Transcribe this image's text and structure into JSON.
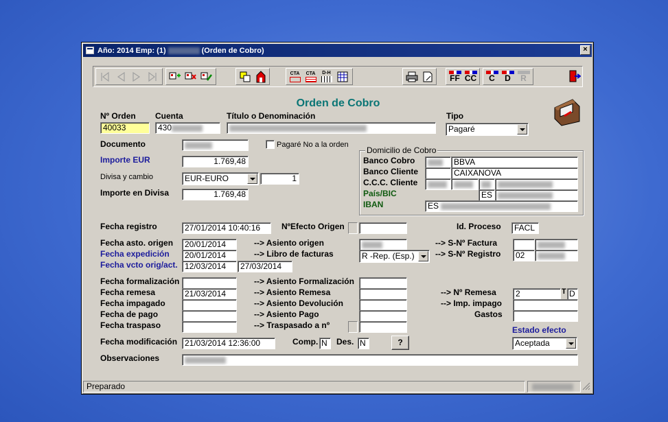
{
  "window": {
    "title_prefix": "Año: 2014 Emp: (1)",
    "title_suffix": "(Orden de Cobro)",
    "close": "×"
  },
  "toolbar": {
    "cta": "CTA",
    "dh": "D-H",
    "ff": "FF",
    "cc": "CC",
    "c": "C",
    "d": "D",
    "r": "R"
  },
  "form": {
    "heading": "Orden de Cobro",
    "n_orden_label": "Nº Orden",
    "n_orden": "40033",
    "cuenta_label": "Cuenta",
    "cuenta": "430",
    "titulo_label": "Título o Denominación",
    "tipo_label": "Tipo",
    "tipo": "Pagaré",
    "documento_label": "Documento",
    "pagare_no_label": "Pagaré No a la orden",
    "importe_eur_label": "Importe EUR",
    "importe_eur": "1.769,48",
    "divisa_label": "Divisa y cambio",
    "divisa": "EUR-EURO",
    "cambio": "1",
    "importe_divisa_label": "Importe en Divisa",
    "importe_divisa": "1.769,48",
    "domicilio": {
      "title": "Domicilio de Cobro",
      "banco_cobro_label": "Banco Cobro",
      "banco_cobro": "BBVA",
      "banco_cliente_label": "Banco Cliente",
      "banco_cliente": "CAIXANOVA",
      "ccc_label": "C.C.C. Cliente",
      "pais_label": "País/BIC",
      "pais": "ES",
      "iban_label": "IBAN",
      "iban": "ES"
    },
    "fecha_registro_label": "Fecha registro",
    "fecha_registro": "27/01/2014 10:40:16",
    "n_efecto_label": "NºEfecto Origen",
    "id_proceso_label": "Id. Proceso",
    "id_proceso": "FACL",
    "fecha_asto_label": "Fecha asto. origen",
    "fecha_asto": "20/01/2014",
    "asiento_origen_label": "--> Asiento origen",
    "s_factura_label": "--> S-Nº Factura",
    "fecha_exp_label": "Fecha expedición",
    "fecha_exp": "20/01/2014",
    "libro_label": "--> Libro de facturas",
    "libro": "R -Rep. (Esp.)",
    "s_registro_label": "--> S-Nº Registro",
    "s_registro": "02",
    "fecha_vcto_label": "Fecha vcto orig/act.",
    "fecha_vcto_orig": "12/03/2014",
    "fecha_vcto_act": "27/03/2014",
    "fecha_form_label": "Fecha formalización",
    "asiento_form_label": "--> Asiento Formalización",
    "fecha_remesa_label": "Fecha remesa",
    "fecha_remesa": "21/03/2014",
    "asiento_remesa_label": "--> Asiento Remesa",
    "n_remesa_label": "--> Nº Remesa",
    "n_remesa": "2",
    "t_label": "T",
    "d_value": "D",
    "fecha_impagado_label": "Fecha impagado",
    "asiento_dev_label": "--> Asiento Devolución",
    "imp_impago_label": "--> Imp. impago",
    "fecha_pago_label": "Fecha de pago",
    "asiento_pago_label": "--> Asiento Pago",
    "gastos_label": "Gastos",
    "fecha_traspaso_label": "Fecha traspaso",
    "traspasado_label": "--> Traspasado a nº",
    "estado_label": "Estado efecto",
    "estado": "Aceptada",
    "fecha_mod_label": "Fecha modificación",
    "fecha_mod": "21/03/2014 12:36:00",
    "comp_label": "Comp.",
    "comp": "N",
    "des_label": "Des.",
    "des": "N",
    "help": "?",
    "observaciones_label": "Observaciones"
  },
  "status": {
    "text": "Preparado"
  }
}
